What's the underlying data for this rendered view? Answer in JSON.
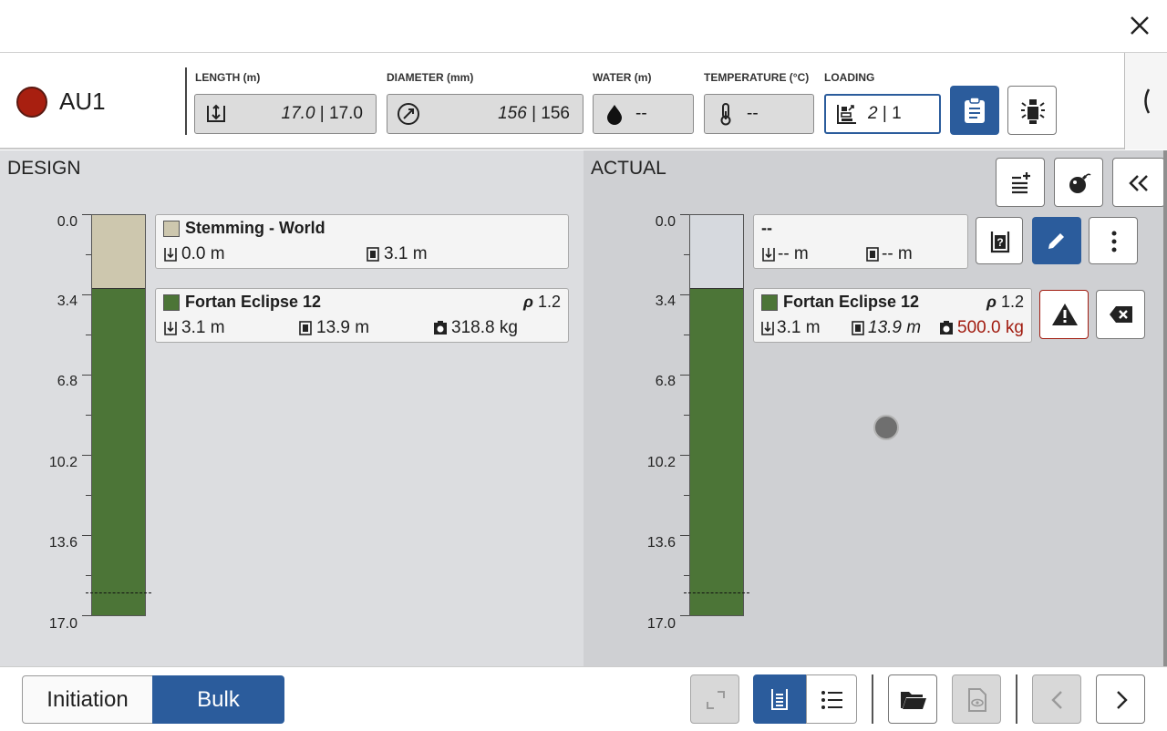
{
  "header": {
    "hole_name": "AU1",
    "status_color": "#a81f10",
    "length": {
      "label": "LENGTH (m)",
      "design": "17.0",
      "actual": "17.0"
    },
    "diameter": {
      "label": "DIAMETER (mm)",
      "design": "156",
      "actual": "156"
    },
    "water": {
      "label": "WATER (m)",
      "value": "--"
    },
    "temperature": {
      "label": "TEMPERATURE (°C)",
      "value": "--"
    },
    "loading": {
      "label": "LOADING",
      "design": "2",
      "actual": "1"
    },
    "sep": "|"
  },
  "design": {
    "title": "DESIGN",
    "ticks": [
      "0.0",
      "3.4",
      "6.8",
      "10.2",
      "13.6",
      "17.0"
    ],
    "decks": [
      {
        "name": "Stemming - World",
        "color": "#cdc7ae",
        "top": "0.0 m",
        "length": "3.1 m"
      },
      {
        "name": "Fortan Eclipse 12",
        "color": "#4c7537",
        "rho_symbol": "ρ",
        "rho": "1.2",
        "top": "3.1 m",
        "length": "13.9 m",
        "mass": "318.8 kg"
      }
    ]
  },
  "actual": {
    "title": "ACTUAL",
    "ticks": [
      "0.0",
      "3.4",
      "6.8",
      "10.2",
      "13.6",
      "17.0"
    ],
    "decks": [
      {
        "name": "--",
        "top": "-- m",
        "length": "-- m"
      },
      {
        "name": "Fortan Eclipse 12",
        "color": "#4c7537",
        "rho_symbol": "ρ",
        "rho": "1.2",
        "top": "3.1 m",
        "length": "13.9 m",
        "mass": "500.0 kg",
        "mass_color": "#a11c10"
      }
    ]
  },
  "footer": {
    "tab_initiation": "Initiation",
    "tab_bulk": "Bulk",
    "active_tab": "Bulk"
  },
  "colors": {
    "accent": "#2b5c9c",
    "stemming": "#cdc7ae",
    "explosive": "#4c7537",
    "warning": "#a11c10"
  },
  "icons": [
    "close-icon",
    "depth-icon",
    "diameter-icon",
    "water-drop-icon",
    "thermometer-icon",
    "loading-icon",
    "clipboard-icon",
    "primer-icon",
    "collapse-panel-icon",
    "add-deck-icon",
    "bomb-icon",
    "double-chevron-left-icon",
    "unknown-product-icon",
    "edit-pencil-icon",
    "more-vert-icon",
    "warning-icon",
    "backspace-icon",
    "expand-icon",
    "column-view-icon",
    "list-view-icon",
    "folder-open-icon",
    "document-preview-icon",
    "chevron-left-icon",
    "chevron-right-icon"
  ]
}
